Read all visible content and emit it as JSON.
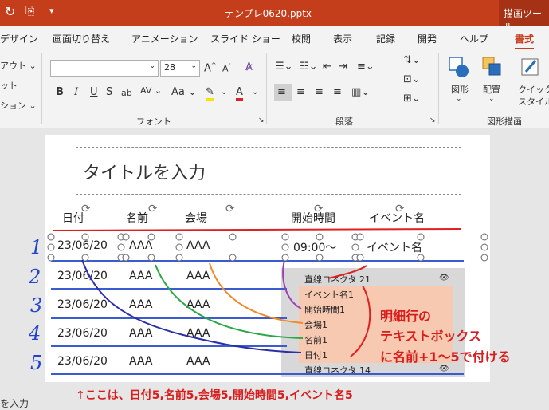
{
  "window": {
    "title": "テンプレ0620.pptx",
    "context_tab": "描画ツール"
  },
  "menu": {
    "tabs": [
      "デザイン",
      "画面切り替え",
      "アニメーション",
      "スライド ショー",
      "校閲",
      "表示",
      "記録",
      "開発",
      "ヘルプ"
    ],
    "active_tab": "書式"
  },
  "ribbon": {
    "left_cut_labels": [
      "アウト ⌄",
      "ット",
      "ション ⌄"
    ],
    "font_size": "28",
    "group_font": "フォント",
    "group_paragraph": "段落",
    "group_shape": "図形描画",
    "shape_label": "図形",
    "arrange_label": "配置",
    "quick_style_label": "クイック\nスタイル",
    "quick_style_line1": "クイック",
    "quick_style_line2": "スタイル"
  },
  "slide": {
    "title_placeholder": "タイトルを入力",
    "headers": [
      "日付",
      "名前",
      "会場",
      "開始時間",
      "イベント名"
    ],
    "selected_row": [
      "23/06/20",
      "AAA",
      "AAA",
      "09:00〜",
      "イベント名"
    ],
    "rows": [
      [
        "23/06/20",
        "AAA",
        "AAA"
      ],
      [
        "23/06/20",
        "AAA",
        "AAA"
      ],
      [
        "23/06/20",
        "AAA",
        "AAA"
      ],
      [
        "23/06/20",
        "AAA",
        "AAA"
      ]
    ],
    "handwritten_numbers": [
      "1",
      "2",
      "3",
      "4",
      "5"
    ]
  },
  "selection_pane": {
    "items": [
      "直線コネクタ 21",
      "イベント名1",
      "開始時間1",
      "会場1",
      "名前1",
      "日付1",
      "直線コネクタ 14"
    ]
  },
  "annotations": {
    "note_line1": "明細行の",
    "note_line2": "テキストボックス",
    "note_line3": "に名前+1〜5で付ける",
    "bottom": "↑ここは、日付5,名前5,会場5,開始時間5,イベント名5"
  },
  "statusbar": {
    "text": "を入力"
  }
}
